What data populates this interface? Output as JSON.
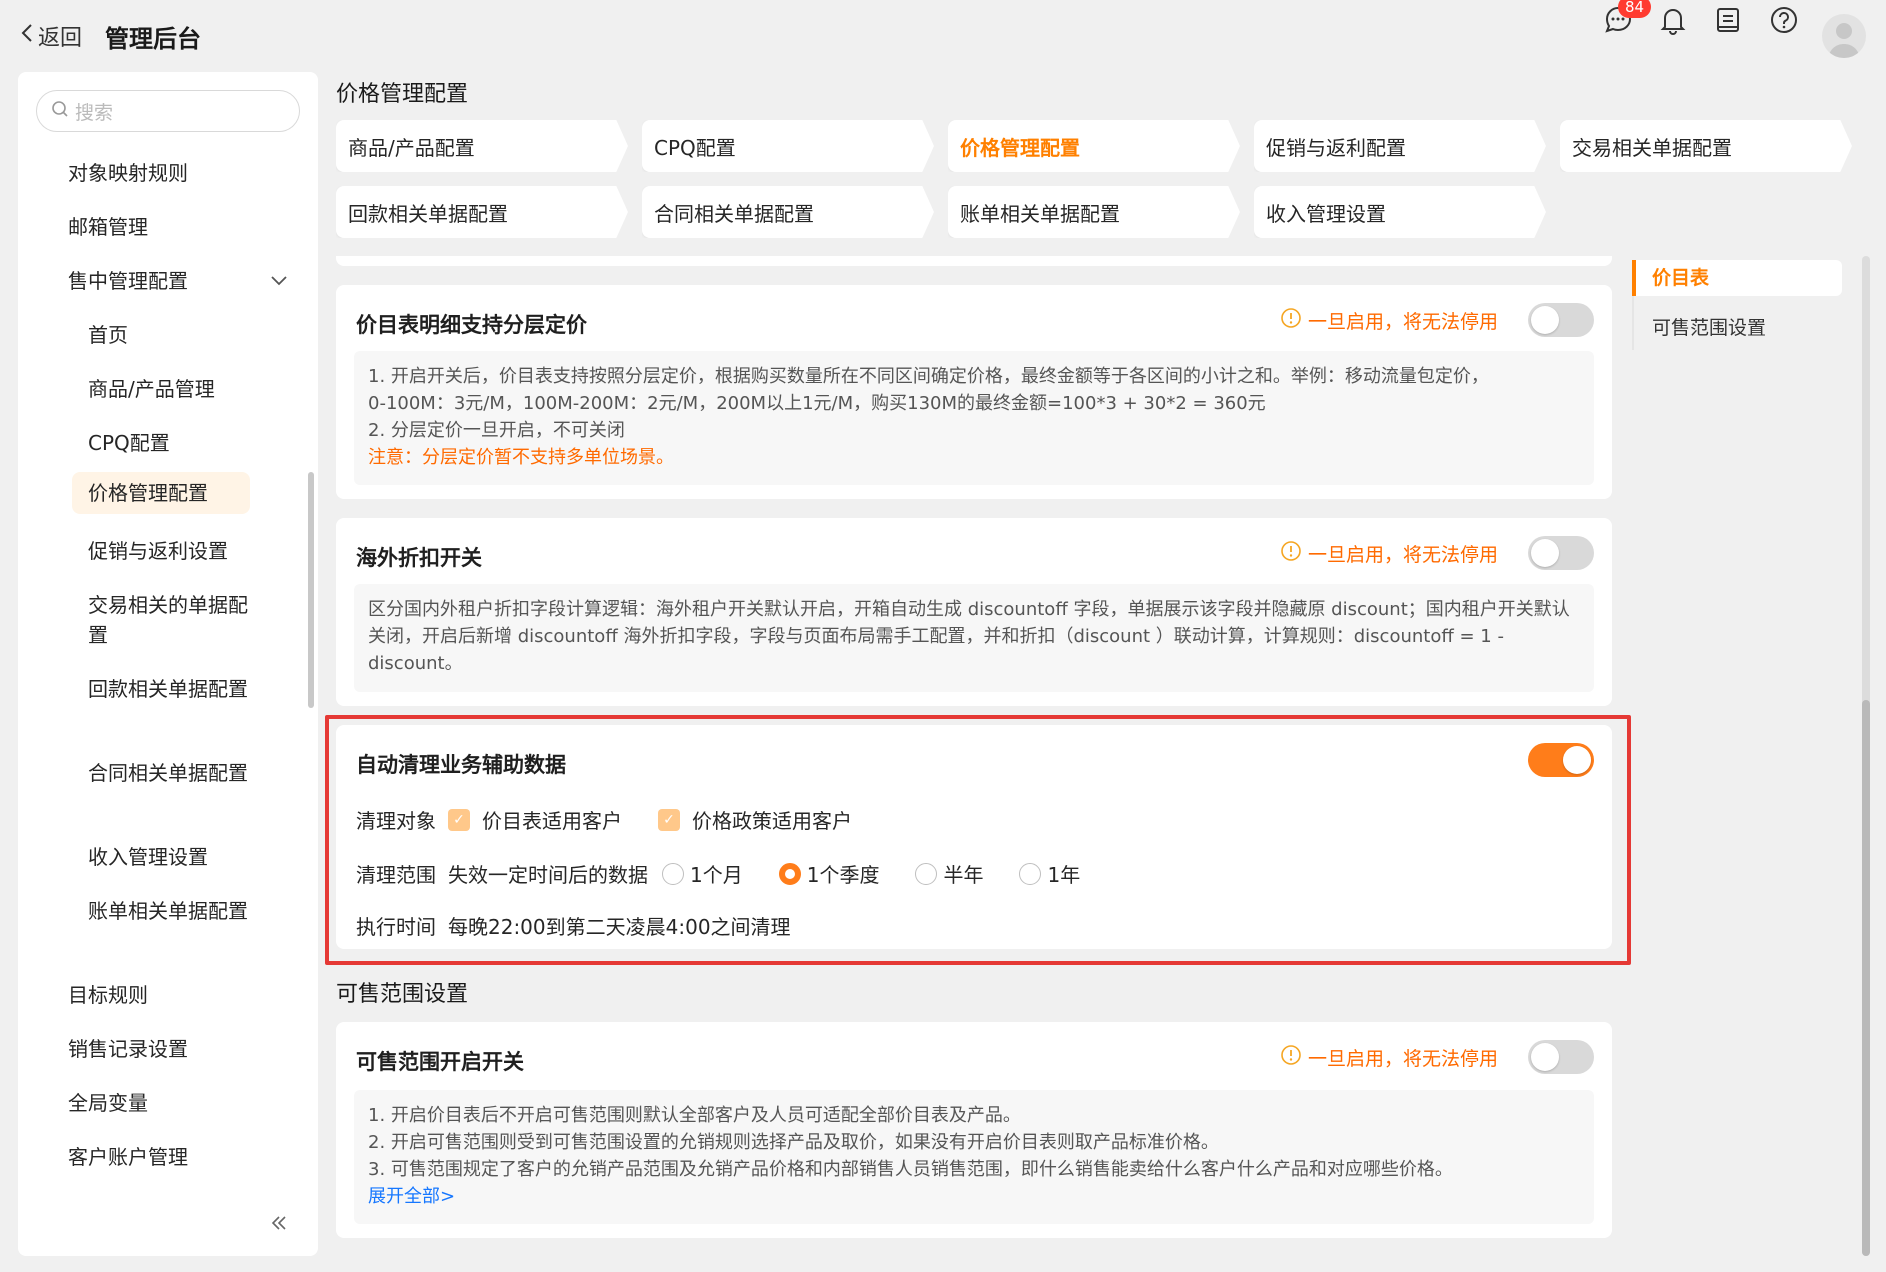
{
  "header": {
    "back_label": "返回",
    "title": "管理后台",
    "message_badge": "84"
  },
  "sidebar": {
    "search_placeholder": "搜索",
    "items": [
      "对象映射规则",
      "邮箱管理",
      "售中管理配置",
      "首页",
      "商品/产品管理",
      "CPQ配置",
      "价格管理配置",
      "促销与返利设置",
      "交易相关的单据配置",
      "回款相关单据配置",
      "合同相关单据配置",
      "收入管理设置",
      "账单相关单据配置",
      "目标规则",
      "销售记录设置",
      "全局变量",
      "客户账户管理"
    ]
  },
  "page": {
    "section_title": "价格管理配置",
    "tabs": [
      "商品/产品配置",
      "CPQ配置",
      "价格管理配置",
      "促销与返利配置",
      "交易相关单据配置",
      "回款相关单据配置",
      "合同相关单据配置",
      "账单相关单据配置",
      "收入管理设置"
    ]
  },
  "cards": {
    "tiered": {
      "title": "价目表明细支持分层定价",
      "warning": "一旦启用，将无法停用",
      "line1": "1. 开启开关后，价目表支持按照分层定价，根据购买数量所在不同区间确定价格，最终金额等于各区间的小计之和。举例：移动流量包定价，",
      "line2": "0-100M：3元/M，100M-200M：2元/M，200M以上1元/M，购买130M的最终金额=100*3 + 30*2 = 360元",
      "line3": "2. 分层定价一旦开启，不可关闭",
      "note": "注意：分层定价暂不支持多单位场景。",
      "enabled": false
    },
    "overseas": {
      "title": "海外折扣开关",
      "warning": "一旦启用，将无法停用",
      "text": "区分国内外租户折扣字段计算逻辑：海外租户开关默认开启，开箱自动生成 discountoff 字段，单据展示该字段并隐藏原 discount；国内租户开关默认关闭，开启后新增 discountoff 海外折扣字段，字段与页面布局需手工配置，并和折扣（discount ）联动计算，计算规则：discountoff = 1 - discount。",
      "enabled": false
    },
    "cleanup": {
      "title": "自动清理业务辅助数据",
      "enabled": true,
      "target_label": "清理对象",
      "targets": [
        "价目表适用客户",
        "价格政策适用客户"
      ],
      "range_label": "清理范围",
      "range_desc": "失效一定时间后的数据",
      "options": [
        "1个月",
        "1个季度",
        "半年",
        "1年"
      ],
      "selected_option": "1个季度",
      "time_label": "执行时间",
      "time_value": "每晚22:00到第二天凌晨4:00之间清理"
    },
    "scope_section_title": "可售范围设置",
    "scope": {
      "title": "可售范围开启开关",
      "warning": "一旦启用，将无法停用",
      "line1": "1. 开启价目表后不开启可售范围则默认全部客户及人员可适配全部价目表及产品。",
      "line2": "2. 开启可售范围则受到可售范围设置的允销规则选择产品及取价，如果没有开启价目表则取产品标准价格。",
      "line3": "3. 可售范围规定了客户的允销产品范围及允销产品价格和内部销售人员销售范围，即什么销售能卖给什么客户什么产品和对应哪些价格。",
      "expand": "展开全部>",
      "enabled": false
    }
  },
  "anchors": [
    "价目表",
    "可售范围设置"
  ],
  "colors": {
    "accent": "#ff7d1a",
    "warning": "#ff6a00",
    "highlight_border": "#e53935",
    "link": "#1677ff"
  }
}
